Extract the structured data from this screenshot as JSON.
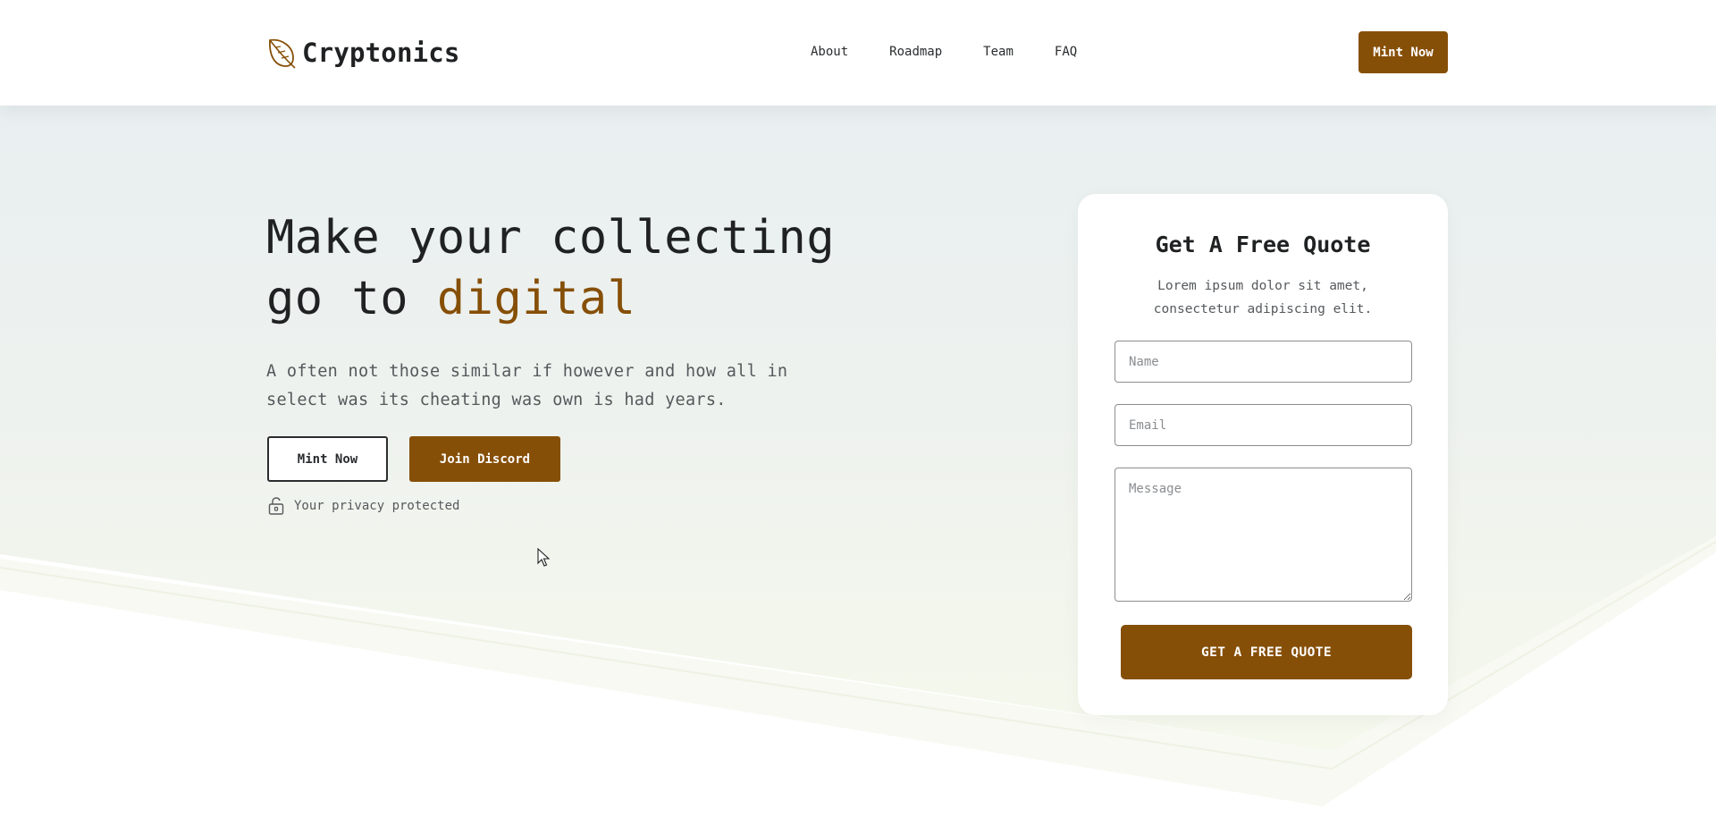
{
  "header": {
    "brand": "Cryptonics",
    "nav": [
      "About",
      "Roadmap",
      "Team",
      "FAQ"
    ],
    "cta_label": "Mint Now"
  },
  "hero": {
    "title_part1": "Make your collecting",
    "title_part2": "go to ",
    "title_accent": "digital",
    "description": "A often not those similar if however and how all in select was its cheating was own is had years.",
    "primary_button": "Mint Now",
    "secondary_button": "Join Discord",
    "privacy_text": "Your privacy protected"
  },
  "quote_form": {
    "title": "Get A Free Quote",
    "subtitle": "Lorem ipsum dolor sit amet, consectetur adipiscing elit.",
    "name_placeholder": "Name",
    "email_placeholder": "Email",
    "message_placeholder": "Message",
    "submit_label": "GET A FREE QUOTE"
  },
  "colors": {
    "accent": "#864f07",
    "text_dark": "#1f2122",
    "text_muted": "#55595c",
    "hero_bg_top": "#e8eff2",
    "hero_bg_bottom": "#f4f7ee"
  },
  "icons": {
    "logo": "leaf-icon",
    "privacy": "unlock-icon",
    "cursor": "mouse-pointer-icon"
  }
}
